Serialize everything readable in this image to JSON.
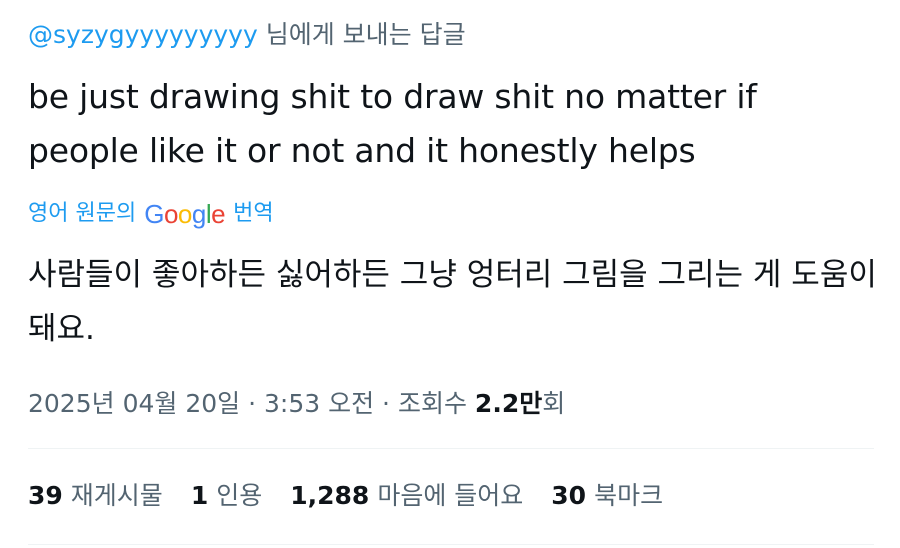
{
  "reply": {
    "handle": "@syzygyyyyyyyyy",
    "suffix": "님에게 보내는 답글"
  },
  "tweet": {
    "text": "be just drawing shit to draw shit no matter if people like it or not and it honestly helps"
  },
  "translation": {
    "prefix": "영어 원문의",
    "google_letters": [
      {
        "char": "G",
        "color": "#4285F4"
      },
      {
        "char": "o",
        "color": "#EA4335"
      },
      {
        "char": "o",
        "color": "#FBBC05"
      },
      {
        "char": "g",
        "color": "#4285F4"
      },
      {
        "char": "l",
        "color": "#34A853"
      },
      {
        "char": "e",
        "color": "#EA4335"
      }
    ],
    "suffix": "번역",
    "text": "사람들이 좋아하든 싫어하든 그냥 엉터리 그림을 그리는 게 도움이 돼요."
  },
  "meta": {
    "date": "2025년 04월 20일",
    "separator": "·",
    "time": "3:53 오전",
    "views_label": "조회수",
    "views_count": "2.2만",
    "views_suffix": "회"
  },
  "stats": [
    {
      "count": "39",
      "label": "재게시물"
    },
    {
      "count": "1",
      "label": "인용"
    },
    {
      "count": "1,288",
      "label": "마음에 들어요"
    },
    {
      "count": "30",
      "label": "북마크"
    }
  ],
  "colors": {
    "link": "#1d9bf0",
    "text": "#0f1419",
    "secondary": "#536471",
    "divider": "#eff3f4"
  }
}
